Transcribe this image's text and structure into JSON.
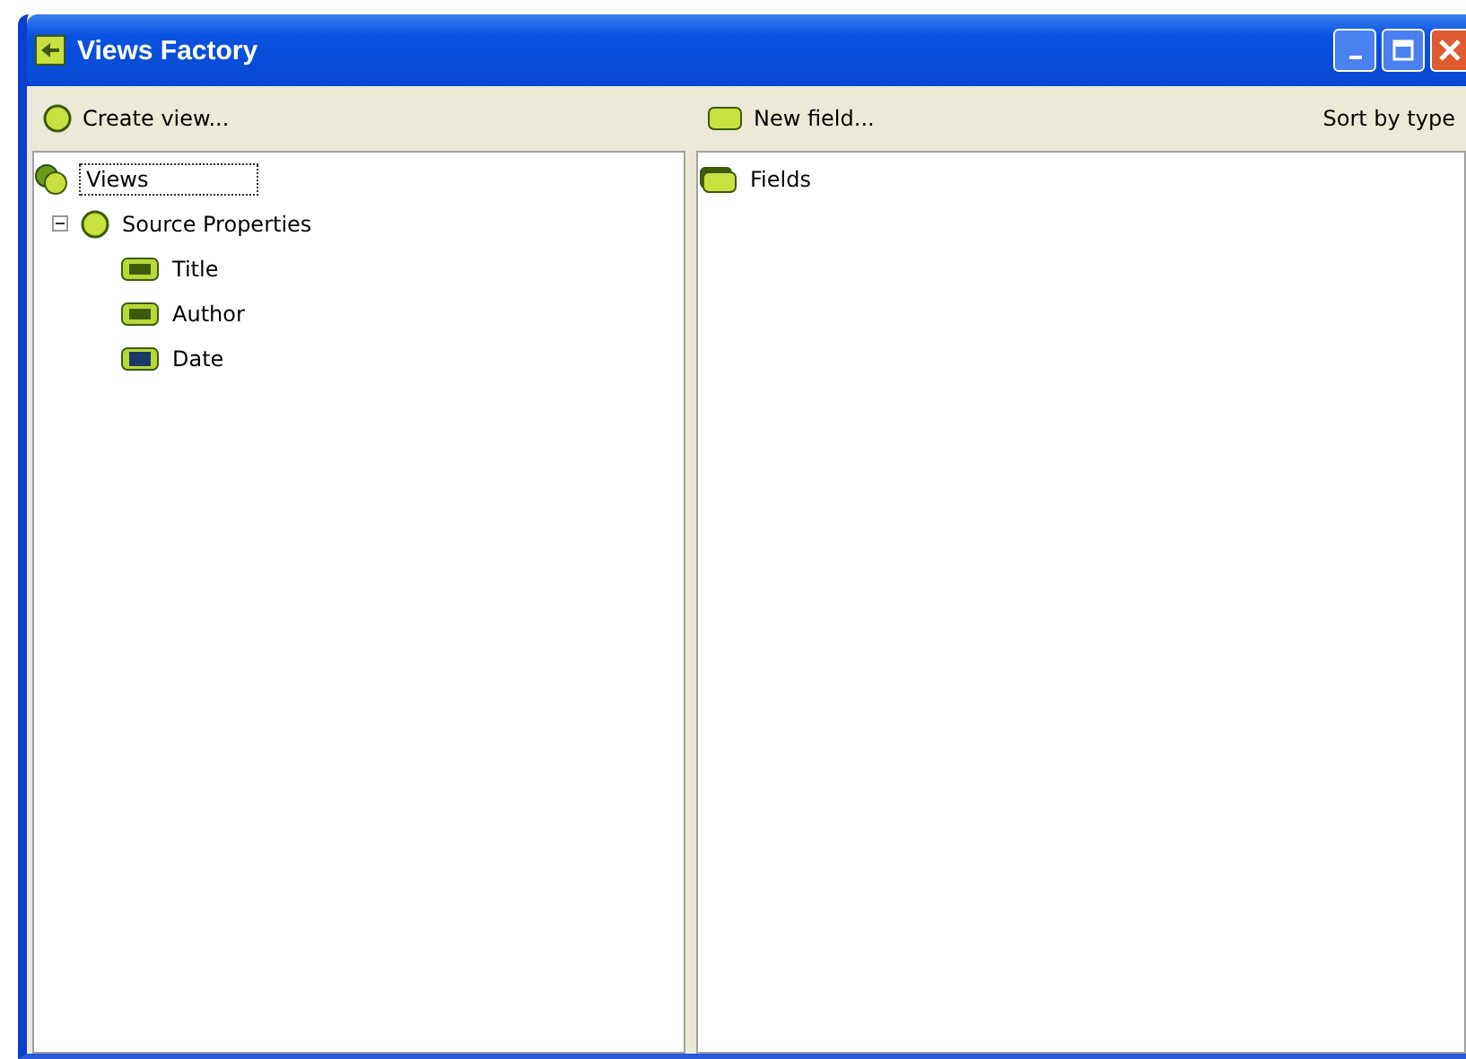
{
  "window": {
    "title": "Views Factory"
  },
  "left_toolbar": {
    "button": "Create view..."
  },
  "right_toolbar": {
    "button": "New field...",
    "sort": "Sort by type"
  },
  "views_tree": [
    {
      "label": "Views",
      "selected": true,
      "kind": "root",
      "children": [
        {
          "label": "Source Properties",
          "kind": "group",
          "expanded": true,
          "children": [
            {
              "label": "Title",
              "kind": "text"
            },
            {
              "label": "Author",
              "kind": "text"
            },
            {
              "label": "Date",
              "kind": "date"
            }
          ]
        }
      ]
    }
  ],
  "fields_tree": [
    {
      "label": "Fields",
      "kind": "folder"
    }
  ]
}
